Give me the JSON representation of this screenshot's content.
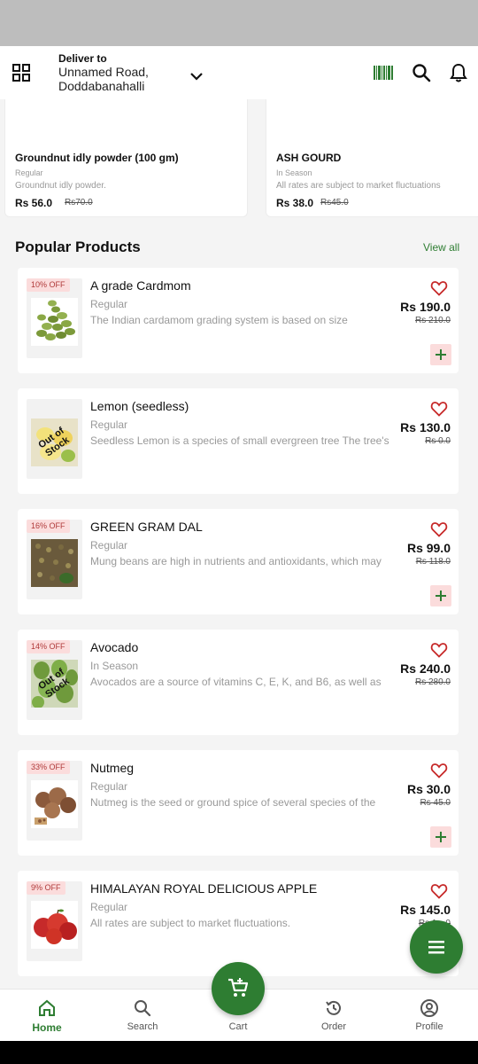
{
  "header": {
    "deliver_label": "Deliver to",
    "address_line1": "Unnamed Road,",
    "address_line2": "Doddabanahalli"
  },
  "featured": [
    {
      "name": "Groundnut idly powder (100 gm)",
      "category": "Regular",
      "description": "Groundnut idly powder.",
      "price": "Rs 56.0",
      "old_price": "Rs70.0"
    },
    {
      "name": "ASH GOURD",
      "category": "In Season",
      "description": "All rates are subject to market fluctuations",
      "price": "Rs 38.0",
      "old_price": "Rs45.0"
    }
  ],
  "popular": {
    "title": "Popular Products",
    "view_all": "View all",
    "items": [
      {
        "badge": "10% OFF",
        "name": "A grade Cardmom",
        "category": "Regular",
        "description": "The Indian cardamom grading system is based on size",
        "price": "Rs 190.0",
        "old_price": "Rs 210.0",
        "image": "cardamom-image"
      },
      {
        "badge": "",
        "name": "Lemon (seedless)",
        "category": "Regular",
        "description": "Seedless Lemon is a species of small evergreen tree The tree's",
        "price": "Rs 130.0",
        "old_price": "Rs 0.0",
        "stock_overlay": "Out of Stock",
        "image": "lemon-image"
      },
      {
        "badge": "16% OFF",
        "name": "GREEN GRAM DAL",
        "category": "Regular",
        "description": "Mung beans are high in nutrients and antioxidants, which may",
        "price": "Rs 99.0",
        "old_price": "Rs 118.0",
        "image": "green-gram-image"
      },
      {
        "badge": "14% OFF",
        "name": "Avocado",
        "category": "In Season",
        "description": "Avocados are a source of vitamins C, E, K, and B6, as well as",
        "price": "Rs 240.0",
        "old_price": "Rs 280.0",
        "stock_overlay": "Out of Stock",
        "image": "avocado-image"
      },
      {
        "badge": "33% OFF",
        "name": "Nutmeg",
        "category": "Regular",
        "description": "Nutmeg is the seed or ground spice of several species of the",
        "price": "Rs 30.0",
        "old_price": "Rs 45.0",
        "image": "nutmeg-image"
      },
      {
        "badge": "9% OFF",
        "name": "HIMALAYAN ROYAL DELICIOUS APPLE",
        "category": "Regular",
        "description": "All rates are subject to market fluctuations.",
        "price": "Rs 145.0",
        "old_price": "Rs 1…0",
        "image": "apple-image"
      }
    ]
  },
  "bottom_nav": [
    {
      "label": "Home",
      "icon": "home-icon"
    },
    {
      "label": "Search",
      "icon": "search-icon"
    },
    {
      "label": "Cart",
      "icon": "cart-icon"
    },
    {
      "label": "Order",
      "icon": "history-icon"
    },
    {
      "label": "Profile",
      "icon": "profile-icon"
    }
  ],
  "colors": {
    "brand_green": "#2e7d32",
    "badge_bg": "#fbdcdc",
    "badge_text": "#b03a3a",
    "heart_red": "#c62828"
  }
}
